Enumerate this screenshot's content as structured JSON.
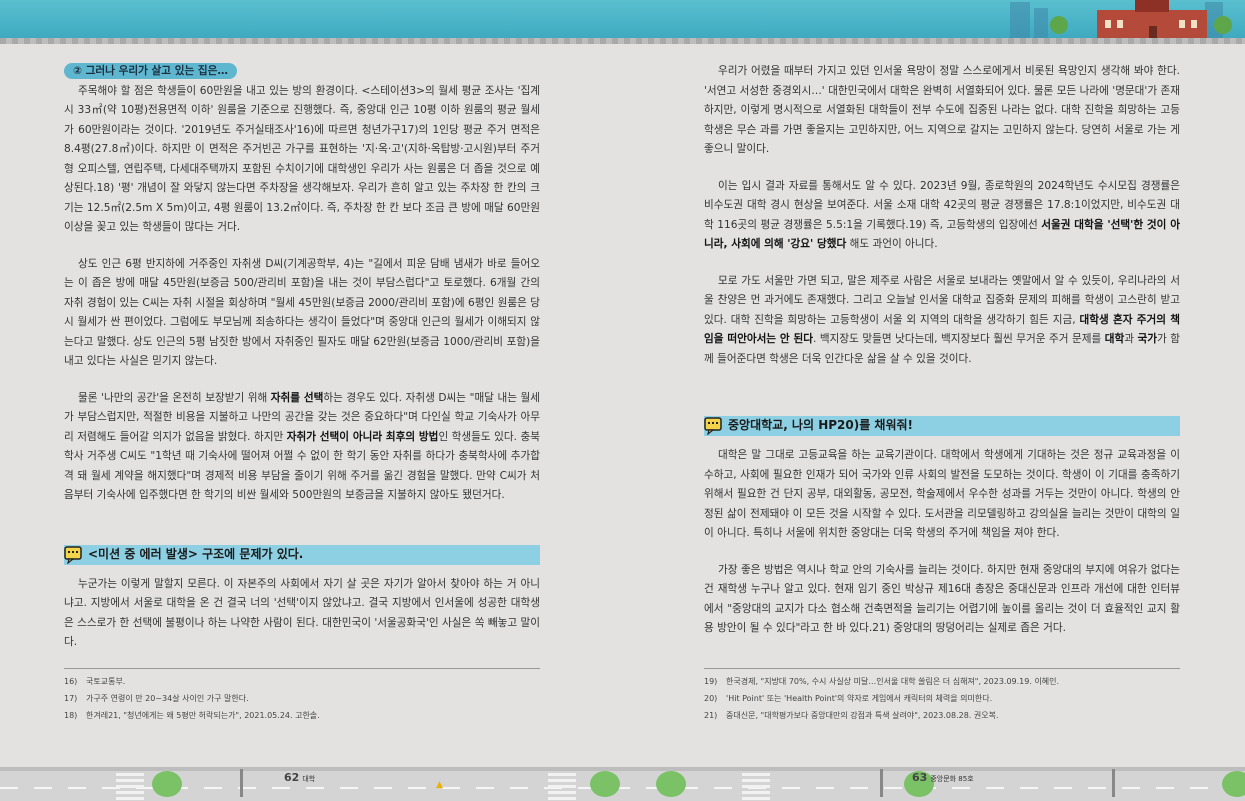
{
  "left": {
    "tag": "② 그러나 우리가 살고 있는 집은…",
    "p1": "주목해야 할 점은 학생들이 60만원을 내고 있는 방의 환경이다. <스테이션3>의 월세 평균 조사는 '집계시 33㎡(약 10평)전용면적 이하' 원룸을 기준으로 진행했다. 즉, 중앙대 인근 10평 이하 원룸의 평균 월세가 60만원이라는 것이다. '2019년도 주거실태조사'16)에 따르면 청년가구17)의 1인당 평균 주거 면적은 8.4평(27.8㎡)이다. 하지만 이 면적은 주거빈곤 가구를 표현하는 '지·옥·고'(지하·옥탑방·고시원)부터 주거형 오피스텔, 연립주택, 다세대주택까지 포함된 수치이기에 대학생인 우리가 사는 원룸은 더 좁을 것으로 예상된다.18) '평' 개념이 잘 와닿지 않는다면 주차장을 생각해보자. 우리가 흔히 알고 있는 주차장 한 칸의 크기는 12.5㎡(2.5m X 5m)이고, 4평 원룸이 13.2㎡이다. 즉, 주차장 한 칸 보다 조금 큰 방에 매달 60만원 이상을 꽂고 있는 학생들이 많다는 거다.",
    "p2": "상도 인근 6평 반지하에 거주중인 자취생 D씨(기계공학부, 4)는 \"길에서 피운 담배 냄새가 바로 들어오는 이 좁은 방에 매달 45만원(보증금 500/관리비 포함)을 내는 것이 부담스럽다\"고 토로했다. 6개월 간의 자취 경험이 있는 C씨는 자취 시절을 회상하며 \"월세 45만원(보증금 2000/관리비 포함)에 6평인 원룸은 당시 월세가 싼 편이었다. 그럼에도 부모님께 죄송하다는 생각이 들었다\"며 중앙대 인근의 월세가 이해되지 않는다고 말했다. 상도 인근의 5평 남짓한 방에서 자취중인 필자도 매달 62만원(보증금 1000/관리비 포함)을 내고 있다는 사실은 믿기지 않는다.",
    "p3a": "물론 '나만의 공간'을 온전히 보장받기 위해 ",
    "p3b": "자취를 선택",
    "p3c": "하는 경우도 있다. 자취생 D씨는 \"매달 내는 월세가 부담스럽지만, 적절한 비용을 지불하고 나만의 공간을 갖는 것은 중요하다\"며 다인실 학교 기숙사가 아무리 저렴해도 들어갈 의지가 없음을 밝혔다. 하지만 ",
    "p3d": "자취가 선택이 아니라 최후의 방법",
    "p3e": "인 학생들도 있다. 충북학사 거주생 C씨도 \"1학년 때 기숙사에 떨어져 어쩔 수 없이 한 학기 동안 자취를 하다가 충북학사에 추가합격 돼 월세 계약을 해지했다\"며 경제적 비용 부담을 줄이기 위해 주거를 옮긴 경험을 말했다. 만약 C씨가 처음부터 기숙사에 입주했다면 한 학기의 비싼 월세와 500만원의 보증금을 지불하지 않아도 됐던거다.",
    "section": "<미션 중 에러 발생> 구조에 문제가 있다.",
    "p4": "누군가는 이렇게 말할지 모른다. 이 자본주의 사회에서 자기 살 곳은 자기가 알아서 찾아야 하는 거 아니냐고. 지방에서 서울로 대학을 온 건 결국 너의 '선택'이지 않았냐고. 결국 지방에서 인서울에 성공한 대학생은 스스로가 한 선택에 불평이나 하는 나약한 사람이 된다. 대한민국이 '서울공화국'인 사실은 쏙 빼놓고 말이다.",
    "footnotes": [
      {
        "n": "16)",
        "t": "국토교통부."
      },
      {
        "n": "17)",
        "t": "가구주 연령이 만 20~34살 사이인 가구 말한다."
      },
      {
        "n": "18)",
        "t": "한겨레21, \"청년에게는 왜 5평만 허락되는가\", 2021.05.24. 고한솔."
      }
    ],
    "page_number": "62",
    "page_label": "대학"
  },
  "right": {
    "p1": "우리가 어렸을 때부터 가지고 있던 인서울 욕망이 정말 스스로에게서 비롯된 욕망인지 생각해 봐야 한다. '서연고 서성한 중경외시…' 대한민국에서 대학은 완벽히 서열화되어 있다. 물론 모든 나라에 '명문대'가 존재하지만, 이렇게 명시적으로 서열화된 대학들이 전부 수도에 집중된 나라는 없다. 대학 진학을 희망하는 고등학생은 무슨 과를 가면 좋을지는 고민하지만, 어느 지역으로 갈지는 고민하지 않는다. 당연히 서울로 가는 게 좋으니 말이다.",
    "p2a": "이는 입시 결과 자료를 통해서도 알 수 있다. 2023년 9월, 종로학원의 2024학년도 수시모집 경쟁률은 비수도권 대학 경시 현상을 보여준다. 서울 소재 대학 42곳의 평균 경쟁률은 17.8:1이었지만, 비수도권 대학 116곳의 평균 경쟁률은 5.5:1을 기록했다.19) 즉, 고등학생의 입장에선 ",
    "p2b": "서울권 대학을 '선택'한 것이 아니라, 사회에 의해 '강요' 당했다",
    "p2c": " 해도 과언이 아니다.",
    "p3a": "모로 가도 서울만 가면 되고, 말은 제주로 사람은 서울로 보내라는 옛말에서 알 수 있듯이, 우리나라의 서울 찬양은 먼 과거에도 존재했다. 그리고 오늘날 인서울 대학교 집중화 문제의 피해를 학생이 고스란히 받고 있다. 대학 진학을 희망하는 고등학생이 서울 외 지역의 대학을 생각하기 힘든 지금, ",
    "p3b": "대학생 혼자 주거의 책임을 떠안아서는 안 된다",
    "p3c": ". 백지장도 맞들면 낫다는데, 백지장보다 훨씬 무거운 주거 문제를 ",
    "p3d": "대학",
    "p3e": "과 ",
    "p3f": "국가",
    "p3g": "가 함께 들어준다면 학생은 더욱 인간다운 삶을 살 수 있을 것이다.",
    "section": "중앙대학교, 나의 HP20)를 채워줘!",
    "p4": "대학은 말 그대로 고등교육을 하는 교육기관이다. 대학에서 학생에게 기대하는 것은 정규 교육과정을 이수하고, 사회에 필요한 인재가 되어 국가와 인류 사회의 발전을 도모하는 것이다. 학생이 이 기대를 충족하기 위해서 필요한 건 단지 공부, 대외활동, 공모전, 학술제에서 우수한 성과를 거두는 것만이 아니다. 학생의 안정된 삶이 전제돼야 이 모든 것을 시작할 수 있다. 도서관을 리모델링하고 강의실을 늘리는 것만이 대학의 일이 아니다. 특히나 서울에 위치한 중앙대는 더욱 학생의 주거에 책임을 져야 한다.",
    "p5": "가장 좋은 방법은 역시나 학교 안의 기숙사를 늘리는 것이다. 하지만 현재 중앙대의 부지에 여유가 없다는 건 재학생 누구나 알고 있다. 현재 임기 중인 박상규 제16대 총장은 중대신문과 인프라 개선에 대한 인터뷰에서 \"중앙대의 교지가 다소 협소해 건축면적을 늘리기는 어렵기에 높이를 올리는 것이 더 효율적인 교지 활용 방안이 될 수 있다\"라고 한 바 있다.21) 중앙대의 땅덩어리는 실제로 좁은 거다.",
    "footnotes": [
      {
        "n": "19)",
        "t": "한국경제, \"지방대 70%, 수시 사실상 미달…인서울 대학 쏠림은 더 심해져\", 2023.09.19. 이혜인."
      },
      {
        "n": "20)",
        "t": "'Hit Point' 또는 'Health Point'의 약자로 게임에서 캐릭터의 체력을 의미한다."
      },
      {
        "n": "21)",
        "t": "중대신문, \"대학평가보다 중앙대만의 강점과 특색 살려야\", 2023.08.28. 권오복."
      }
    ],
    "page_number": "63",
    "page_label": "중앙문화 85호"
  },
  "colors": {
    "accent": "#8dd0e3",
    "tag": "#5fb7cf",
    "top": "#3aa6bd"
  },
  "icons": [
    "speech-bubble-icon"
  ]
}
